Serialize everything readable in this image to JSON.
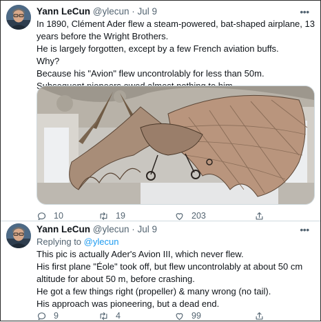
{
  "tweets": [
    {
      "author_name": "Yann LeCun",
      "handle": "@ylecun",
      "date": "Jul 9",
      "more": "•••",
      "text_lines": [
        "In 1890, Clément Ader flew a steam-powered, bat-shaped airplane, 13",
        "years before the Wright Brothers.",
        "He is largely forgotten, except by a few French aviation buffs.",
        "Why?",
        "Because his \"Avion\" flew uncontrolably for less than 50m.",
        "Subsequent pioneers owed almost nothing to him"
      ],
      "counts": {
        "replies": "10",
        "retweets": "19",
        "likes": "203"
      }
    },
    {
      "author_name": "Yann LeCun",
      "handle": "@ylecun",
      "date": "Jul 9",
      "more": "•••",
      "replying_label": "Replying to",
      "replying_handle": "@ylecun",
      "text_lines": [
        "This pic is actually Ader's Avion III, which never flew.",
        "His first plane \"Éole\" took off, but flew uncontrolably at about 50 cm",
        "altitude for about 50 m, before crashing.",
        "He got a few things right (propeller) & many wrong (no tail).",
        "His approach was pioneering, but a dead end."
      ],
      "counts": {
        "replies": "9",
        "retweets": "4",
        "likes": "99"
      }
    }
  ],
  "separator": "·",
  "icons": [
    "reply-icon",
    "retweet-icon",
    "like-icon",
    "share-icon",
    "more-icon"
  ],
  "colors": {
    "text": "#0f1419",
    "meta": "#536471",
    "link": "#1d9bf0",
    "border": "#cfd9de"
  }
}
